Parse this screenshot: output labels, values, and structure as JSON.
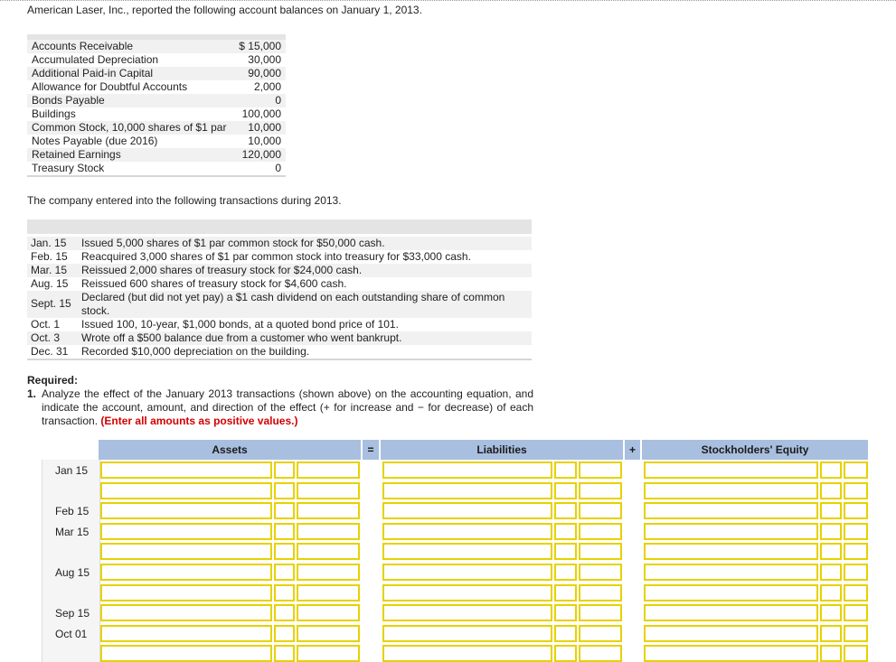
{
  "intro": "American Laser, Inc., reported the following account balances on January 1, 2013.",
  "balances": [
    {
      "account": "Accounts Receivable",
      "amount": "$ 15,000"
    },
    {
      "account": "Accumulated Depreciation",
      "amount": "30,000"
    },
    {
      "account": "Additional Paid-in Capital",
      "amount": "90,000"
    },
    {
      "account": "Allowance for Doubtful Accounts",
      "amount": "2,000"
    },
    {
      "account": "Bonds Payable",
      "amount": "0"
    },
    {
      "account": "Buildings",
      "amount": "100,000"
    },
    {
      "account": "Common Stock, 10,000 shares of $1 par",
      "amount": "10,000"
    },
    {
      "account": "Notes Payable (due 2016)",
      "amount": "10,000"
    },
    {
      "account": "Retained Earnings",
      "amount": "120,000"
    },
    {
      "account": "Treasury Stock",
      "amount": "0"
    }
  ],
  "transactions_intro": "The company entered into the following transactions during 2013.",
  "transactions": [
    {
      "date": "Jan. 15",
      "text": "Issued 5,000 shares of $1 par common stock for $50,000 cash."
    },
    {
      "date": "Feb. 15",
      "text": "Reacquired 3,000 shares of $1 par common stock into treasury for $33,000 cash."
    },
    {
      "date": "Mar. 15",
      "text": "Reissued 2,000 shares of treasury stock for $24,000 cash."
    },
    {
      "date": "Aug. 15",
      "text": "Reissued 600 shares of treasury stock for $4,600 cash."
    },
    {
      "date": "Sept. 15",
      "text": "Declared (but did not yet pay) a $1 cash dividend on each outstanding share of common stock."
    },
    {
      "date": "Oct. 1",
      "text": "Issued 100, 10-year, $1,000 bonds, at a quoted bond price of 101."
    },
    {
      "date": "Oct. 3",
      "text": "Wrote off a $500 balance due from a customer who went bankrupt."
    },
    {
      "date": "Dec. 31",
      "text": "Recorded $10,000 depreciation on the building."
    }
  ],
  "required": {
    "heading": "Required:",
    "number": "1.",
    "text": "Analyze the effect of the January 2013 transactions (shown above) on the accounting equation, and indicate the account, amount, and direction of the effect (+ for increase and − for decrease) of each transaction.",
    "note": "(Enter all amounts as positive values.)"
  },
  "table": {
    "headers": {
      "assets": "Assets",
      "eq": "=",
      "liabilities": "Liabilities",
      "plus": "+",
      "equity": "Stockholders' Equity"
    },
    "row_dates": [
      {
        "label": "Jan 15",
        "row": 0
      },
      {
        "label": "Feb 15",
        "row": 2
      },
      {
        "label": "Mar 15",
        "row": 3
      },
      {
        "label": "Aug 15",
        "row": 5
      },
      {
        "label": "Sep 15",
        "row": 7
      },
      {
        "label": "Oct 01",
        "row": 8
      }
    ]
  }
}
